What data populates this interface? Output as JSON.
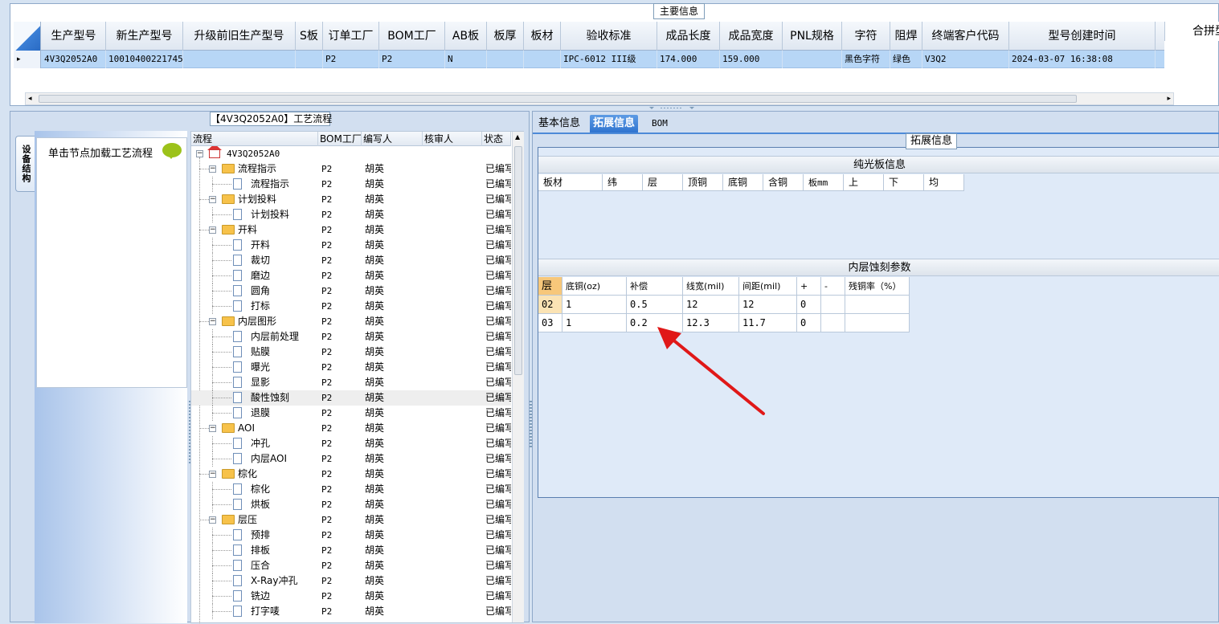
{
  "main_info": {
    "title": "主要信息",
    "columns": [
      "生产型号",
      "新生产型号",
      "升级前旧生产型号",
      "S板",
      "订单工厂",
      "BOM工厂",
      "AB板",
      "板厚",
      "板材",
      "验收标准",
      "成品长度",
      "成品宽度",
      "PNL规格",
      "字符",
      "阻焊",
      "终端客户代码",
      "型号创建时间"
    ],
    "row": [
      "4V3Q2052A0",
      "10010400221745",
      "",
      "",
      "P2",
      "P2",
      "N",
      "",
      "",
      "IPC-6012 III级",
      "174.000",
      "159.000",
      "",
      "黑色字符",
      "绿色",
      "V3Q2",
      "2024-03-07 16:38:08"
    ],
    "row_indicator": "▸",
    "merge_label": "合拼型号"
  },
  "left_pane": {
    "title": "【4V3Q2052A0】工艺流程",
    "vertical_tab": "设备结构",
    "hint": "单击节点加载工艺流程",
    "columns": [
      "流程",
      "BOM工厂",
      "编写人",
      "核审人",
      "状态"
    ],
    "root": "4V3Q2052A0",
    "nodes": [
      {
        "label": "流程指示",
        "type": "folder",
        "bom": "P2",
        "writer": "胡英",
        "reviewer": "",
        "status": "已编写"
      },
      {
        "label": "流程指示",
        "type": "doc",
        "bom": "P2",
        "writer": "胡英",
        "reviewer": "",
        "status": "已编写"
      },
      {
        "label": "计划投料",
        "type": "folder",
        "bom": "P2",
        "writer": "胡英",
        "reviewer": "",
        "status": "已编写"
      },
      {
        "label": "计划投料",
        "type": "doc",
        "bom": "P2",
        "writer": "胡英",
        "reviewer": "",
        "status": "已编写"
      },
      {
        "label": "开料",
        "type": "folder",
        "bom": "P2",
        "writer": "胡英",
        "reviewer": "",
        "status": "已编写"
      },
      {
        "label": "开料",
        "type": "doc",
        "bom": "P2",
        "writer": "胡英",
        "reviewer": "",
        "status": "已编写"
      },
      {
        "label": "裁切",
        "type": "doc",
        "bom": "P2",
        "writer": "胡英",
        "reviewer": "",
        "status": "已编写"
      },
      {
        "label": "磨边",
        "type": "doc",
        "bom": "P2",
        "writer": "胡英",
        "reviewer": "",
        "status": "已编写"
      },
      {
        "label": "圆角",
        "type": "doc",
        "bom": "P2",
        "writer": "胡英",
        "reviewer": "",
        "status": "已编写"
      },
      {
        "label": "打标",
        "type": "doc",
        "bom": "P2",
        "writer": "胡英",
        "reviewer": "",
        "status": "已编写"
      },
      {
        "label": "内层图形",
        "type": "folder",
        "bom": "P2",
        "writer": "胡英",
        "reviewer": "",
        "status": "已编写"
      },
      {
        "label": "内层前处理",
        "type": "doc",
        "bom": "P2",
        "writer": "胡英",
        "reviewer": "",
        "status": "已编写"
      },
      {
        "label": "贴膜",
        "type": "doc",
        "bom": "P2",
        "writer": "胡英",
        "reviewer": "",
        "status": "已编写"
      },
      {
        "label": "曝光",
        "type": "doc",
        "bom": "P2",
        "writer": "胡英",
        "reviewer": "",
        "status": "已编写"
      },
      {
        "label": "显影",
        "type": "doc",
        "bom": "P2",
        "writer": "胡英",
        "reviewer": "",
        "status": "已编写"
      },
      {
        "label": "酸性蚀刻",
        "type": "doc",
        "bom": "P2",
        "writer": "胡英",
        "reviewer": "",
        "status": "已编写",
        "selected": true
      },
      {
        "label": "退膜",
        "type": "doc",
        "bom": "P2",
        "writer": "胡英",
        "reviewer": "",
        "status": "已编写"
      },
      {
        "label": "AOI",
        "type": "folder",
        "bom": "P2",
        "writer": "胡英",
        "reviewer": "",
        "status": "已编写"
      },
      {
        "label": "冲孔",
        "type": "doc",
        "bom": "P2",
        "writer": "胡英",
        "reviewer": "",
        "status": "已编写"
      },
      {
        "label": "内层AOI",
        "type": "doc",
        "bom": "P2",
        "writer": "胡英",
        "reviewer": "",
        "status": "已编写"
      },
      {
        "label": "棕化",
        "type": "folder",
        "bom": "P2",
        "writer": "胡英",
        "reviewer": "",
        "status": "已编写"
      },
      {
        "label": "棕化",
        "type": "doc",
        "bom": "P2",
        "writer": "胡英",
        "reviewer": "",
        "status": "已编写"
      },
      {
        "label": "烘板",
        "type": "doc",
        "bom": "P2",
        "writer": "胡英",
        "reviewer": "",
        "status": "已编写"
      },
      {
        "label": "层压",
        "type": "folder",
        "bom": "P2",
        "writer": "胡英",
        "reviewer": "",
        "status": "已编写"
      },
      {
        "label": "预排",
        "type": "doc",
        "bom": "P2",
        "writer": "胡英",
        "reviewer": "",
        "status": "已编写"
      },
      {
        "label": "排板",
        "type": "doc",
        "bom": "P2",
        "writer": "胡英",
        "reviewer": "",
        "status": "已编写"
      },
      {
        "label": "压合",
        "type": "doc",
        "bom": "P2",
        "writer": "胡英",
        "reviewer": "",
        "status": "已编写"
      },
      {
        "label": "X-Ray冲孔",
        "type": "doc",
        "bom": "P2",
        "writer": "胡英",
        "reviewer": "",
        "status": "已编写"
      },
      {
        "label": "铣边",
        "type": "doc",
        "bom": "P2",
        "writer": "胡英",
        "reviewer": "",
        "status": "已编写"
      },
      {
        "label": "打字唛",
        "type": "doc",
        "bom": "P2",
        "writer": "胡英",
        "reviewer": "",
        "status": "已编写"
      }
    ]
  },
  "right_pane": {
    "tabs": [
      "基本信息",
      "拓展信息",
      "BOM"
    ],
    "active_tab": "拓展信息",
    "ext_title": "拓展信息",
    "bare_board": {
      "title": "纯光板信息",
      "columns": [
        "板材",
        "纬",
        "层",
        "顶铜",
        "底铜",
        "含铜",
        "板mm",
        "上",
        "下",
        "均"
      ]
    },
    "etch": {
      "title": "内层蚀刻参数",
      "columns": [
        "层",
        "底铜(oz)",
        "补偿",
        "线宽(mil)",
        "间距(mil)",
        "+",
        "-",
        "残铜率（%）"
      ],
      "rows": [
        [
          "02",
          "1",
          "0.5",
          "12",
          "12",
          "0",
          "",
          ""
        ],
        [
          "03",
          "1",
          "0.2",
          "12.3",
          "11.7",
          "0",
          "",
          ""
        ]
      ]
    },
    "annotation": "red-arrow-pointing-to-compensation"
  },
  "colors": {
    "row_selected": "#b7d6f6",
    "tab_active": "#2f74d0",
    "highlight": "#fbe3b4",
    "arrow": "#e01818"
  }
}
